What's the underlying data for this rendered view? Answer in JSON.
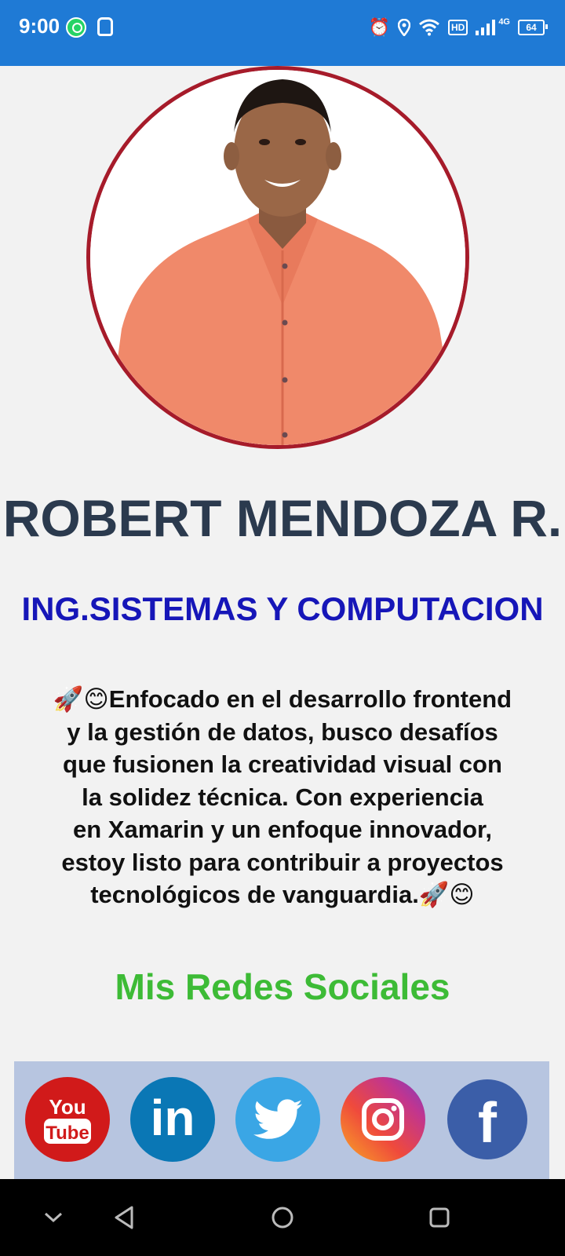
{
  "status_bar": {
    "time": "9:00",
    "battery": "64",
    "network": "4G",
    "hd": "HD",
    "icons": [
      "whatsapp-icon",
      "assistant-icon",
      "alarm-icon",
      "location-icon",
      "wifi-icon",
      "hd-icon",
      "signal-icon",
      "battery-icon"
    ]
  },
  "profile": {
    "name": "ROBERT MENDOZA R.",
    "title": "ING.SISTEMAS Y COMPUTACION",
    "bio_lines": [
      "🚀😊Enfocado en el desarrollo frontend",
      "y la gestión de datos, busco desafíos",
      "que fusionen la creatividad visual con",
      "la solidez técnica. Con experiencia",
      "en Xamarin y un enfoque innovador,",
      "estoy listo para contribuir a proyectos",
      "tecnológicos de vanguardia.🚀😊"
    ]
  },
  "social": {
    "heading": "Mis Redes Sociales",
    "youtube_label_top": "You",
    "youtube_label_bottom": "Tube",
    "linkedin_label": "in",
    "facebook_label": "f",
    "items": [
      "youtube",
      "linkedin",
      "twitter",
      "instagram",
      "facebook"
    ]
  },
  "colors": {
    "status_bar": "#1f7ad5",
    "avatar_ring": "#a61b2a",
    "name": "#2b3a4e",
    "title": "#1616b8",
    "heading": "#3dbb36",
    "social_bar": "#b7c5e0"
  },
  "nav_bar": {
    "icons": [
      "chevron-down-icon",
      "back-icon",
      "home-icon",
      "recents-icon"
    ]
  }
}
